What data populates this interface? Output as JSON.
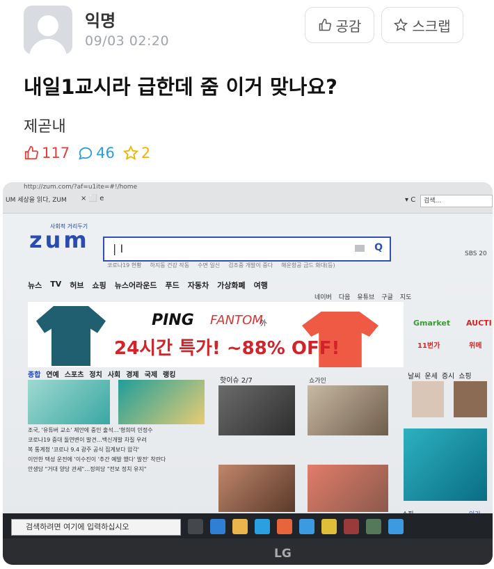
{
  "post": {
    "author": "익명",
    "time": "09/03 02:20",
    "like_button": "공감",
    "scrap_button": "스크랩",
    "title": "내일1교시라 급한데 줌 이거 맞나요?",
    "subtitle": "제곧내",
    "likes": "117",
    "comments": "46",
    "scraps": "2"
  },
  "colors": {
    "like": "#e0433a",
    "comment": "#2a9ed8",
    "scrap": "#f0b400",
    "zum_brand": "#2a4bb0"
  },
  "photo": {
    "browser": {
      "url": "http://zum.com/?af=u1ite=#!/home",
      "tab": "UM 세상을 읽다, ZUM",
      "search_box": "검색..."
    },
    "zum": {
      "tagline": "사회적 거리두기",
      "logo": "zum",
      "related": [
        "코로나19 현황",
        "하지동 건강 작동",
        "수면 일신",
        "검조중 개발이 중다",
        "해운항공 금드 화대(등)"
      ],
      "sbs": "SBS 20",
      "nav": [
        "뉴스",
        "TV",
        "허브",
        "쇼핑",
        "뉴스어라운드",
        "푸드",
        "자동차",
        "가상화폐",
        "여행"
      ],
      "nav_right": [
        "네이버",
        "다음",
        "유튜브",
        "구글",
        "지도"
      ],
      "ad": {
        "brand": "PING",
        "brand2": "FANTOM",
        "suffix": "外",
        "promo": "24시간 특가! ~88% OFF!",
        "gmarket": "Gmarket",
        "auction": "AUCTI",
        "tag1": "11번가",
        "tag2": "위메"
      },
      "categories": [
        "종합",
        "연예",
        "스포츠",
        "정치",
        "사회",
        "경제",
        "국제",
        "랭킹"
      ],
      "issue_title": "핫이슈 2/7",
      "issue2": "쇼가인",
      "right_links": [
        "날씨",
        "운세",
        "증시",
        "쇼핑"
      ],
      "news": [
        "조국, '유튜버 교소' 제안에 중인 출석…'형희미 민정수",
        "코로나19 중대 돌연변이 발견…백신개발 차질 우려",
        "복 통계청 '코로나 9.4 광주 공식 집계보다 압각'",
        "이안한 택성 운전에 '이수진이 '추간 예발 했다' 발전' 착란다",
        "안생담 \"거대 양당 관세\"…정의당 \"전보 정치 유지\""
      ],
      "shopping_label": "쇼핑",
      "popular_label": "인기"
    },
    "taskbar_search": "검색하려면 여기에 입력하십시오",
    "monitor_brand": "LG"
  }
}
